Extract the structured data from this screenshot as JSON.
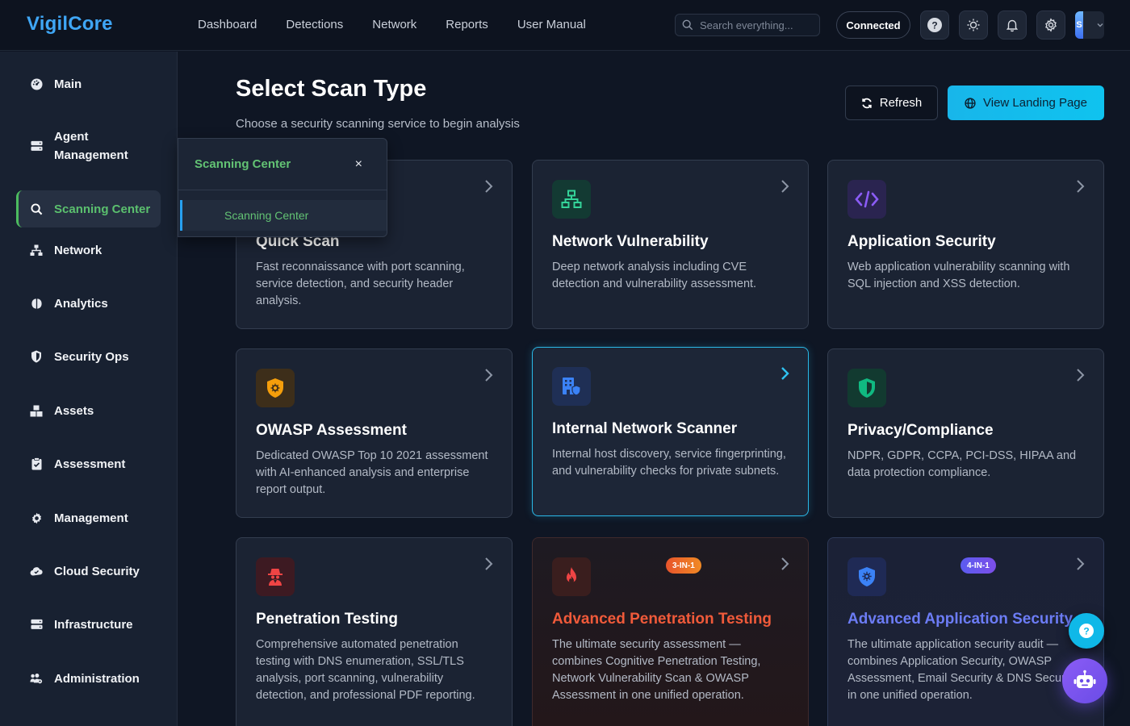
{
  "app": {
    "brand": "VigilCore"
  },
  "topnav": {
    "items": [
      {
        "label": "Dashboard"
      },
      {
        "label": "Detections"
      },
      {
        "label": "Network"
      },
      {
        "label": "Reports"
      },
      {
        "label": "User Manual"
      }
    ],
    "search_placeholder": "Search everything...",
    "status_label": "Connected",
    "avatar_initial": "S",
    "icons": [
      "help-icon",
      "sun-icon",
      "bell-icon",
      "gear-icon"
    ]
  },
  "sidebar": {
    "items": [
      {
        "label": "Main",
        "icon": "dashboard-gauge-icon"
      },
      {
        "label": "Agent Management",
        "icon": "server-icon"
      },
      {
        "label": "Scanning Center",
        "icon": "search-icon",
        "active": true
      },
      {
        "label": "Network",
        "icon": "network-icon"
      },
      {
        "label": "Analytics",
        "icon": "brain-icon"
      },
      {
        "label": "Security Ops",
        "icon": "shield-icon"
      },
      {
        "label": "Assets",
        "icon": "boxes-icon"
      },
      {
        "label": "Assessment",
        "icon": "clipboard-check-icon"
      },
      {
        "label": "Management",
        "icon": "cog-icon"
      },
      {
        "label": "Cloud Security",
        "icon": "cloud-icon"
      },
      {
        "label": "Infrastructure",
        "icon": "server-icon"
      },
      {
        "label": "Administration",
        "icon": "users-cog-icon"
      }
    ]
  },
  "flyout": {
    "title": "Scanning Center",
    "close": "×",
    "item": "Scanning Center"
  },
  "main": {
    "title": "Select Scan Type",
    "subtitle": "Choose a security scanning service to begin analysis",
    "refresh_label": "Refresh",
    "landing_label": "View Landing Page"
  },
  "cards": [
    {
      "title": "Quick Scan",
      "desc": "Fast reconnaissance with port scanning, service detection, and security header analysis.",
      "icon": "bolt-icon"
    },
    {
      "title": "Network Vulnerability",
      "desc": "Deep network analysis including CVE detection and vulnerability assessment.",
      "icon": "network-icon",
      "icon_color": "#34d399",
      "icon_bg": "#133a33"
    },
    {
      "title": "Application Security",
      "desc": "Web application vulnerability scanning with SQL injection and XSS detection.",
      "icon": "code-icon",
      "icon_color": "#8b5cf6",
      "icon_bg": "#2a2450"
    },
    {
      "title": "OWASP Assessment",
      "desc": "Dedicated OWASP Top 10 2021 assessment with AI-enhanced analysis and enterprise report output.",
      "icon": "shield-bug-icon",
      "icon_color": "#f59e0b",
      "icon_bg": "#3d2e1a"
    },
    {
      "title": "Internal Network Scanner",
      "desc": "Internal host discovery, service fingerprinting, and vulnerability checks for private subnets.",
      "icon": "building-shield-icon",
      "icon_color": "#3b82f6",
      "icon_bg": "#1f2f55"
    },
    {
      "title": "Privacy/Compliance",
      "desc": "NDPR, GDPR, CCPA, PCI-DSS, HIPAA and data protection compliance.",
      "icon": "shield-half-icon",
      "icon_color": "#10b981",
      "icon_bg": "#123a30"
    },
    {
      "title": "Penetration Testing",
      "desc": "Comprehensive automated penetration testing with DNS enumeration, SSL/TLS analysis, port scanning, vulnerability detection, and professional PDF reporting.",
      "icon": "user-secret-icon",
      "icon_color": "#ef4444",
      "icon_bg": "#3d1a22"
    },
    {
      "title": "Advanced Penetration Testing",
      "desc": "The ultimate security assessment — combines Cognitive Penetration Testing, Network Vulnerability Scan & OWASP Assessment in one unified operation.",
      "icon": "fire-icon",
      "icon_color": "#ef4444",
      "icon_bg": "#3a1e1e",
      "badge": "3-IN-1",
      "title_color": "#f05a3a"
    },
    {
      "title": "Advanced Application Security",
      "desc": "The ultimate application security audit — combines Application Security, OWASP Assessment, Email Security & DNS Security in one unified operation.",
      "icon": "shield-gear-icon",
      "icon_color": "#3b82f6",
      "icon_bg": "#1f2a55",
      "badge": "4-IN-1",
      "title_color": "#6c7cf5"
    }
  ],
  "floating": {
    "help_icon": "question-icon",
    "bot_icon": "robot-icon"
  }
}
